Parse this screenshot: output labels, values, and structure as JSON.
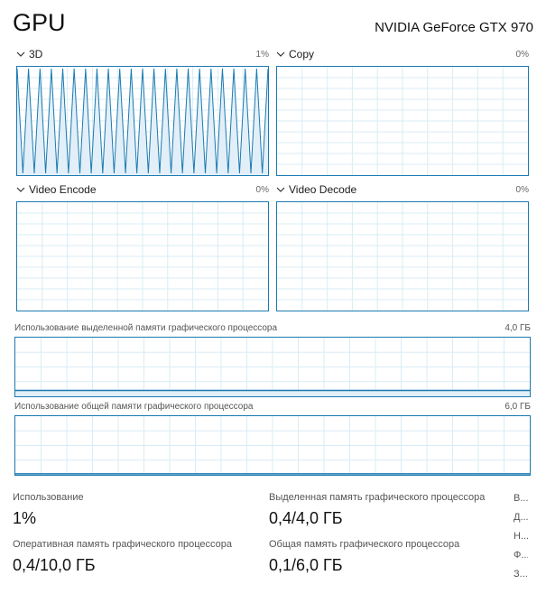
{
  "header": {
    "title": "GPU",
    "device": "NVIDIA GeForce GTX 970"
  },
  "engines": [
    {
      "label": "3D",
      "percent": "1%"
    },
    {
      "label": "Copy",
      "percent": "0%"
    },
    {
      "label": "Video Encode",
      "percent": "0%"
    },
    {
      "label": "Video Decode",
      "percent": "0%"
    }
  ],
  "memory_graphs": [
    {
      "label": "Использование выделенной памяти графического процессора",
      "max": "4,0 ГБ",
      "fill_fraction": 0.1
    },
    {
      "label": "Использование общей памяти графического процессора",
      "max": "6,0 ГБ",
      "fill_fraction": 0.017
    }
  ],
  "stats": {
    "usage": {
      "label": "Использование",
      "value": "1%"
    },
    "dedicated": {
      "label": "Выделенная память графического процессора",
      "value": "0,4/4,0 ГБ"
    },
    "gpu_memory": {
      "label": "Оперативная память графического процессора",
      "value": "0,4/10,0 ГБ"
    },
    "shared": {
      "label": "Общая память графического процессора",
      "value": "0,1/6,0 ГБ"
    }
  },
  "side_column": [
    "В...",
    "Д...",
    "Н...",
    "Ф...",
    "З..."
  ],
  "colors": {
    "line": "#1a7ab0",
    "grid": "#d9ecf5",
    "fill": "#e2eff8"
  }
}
